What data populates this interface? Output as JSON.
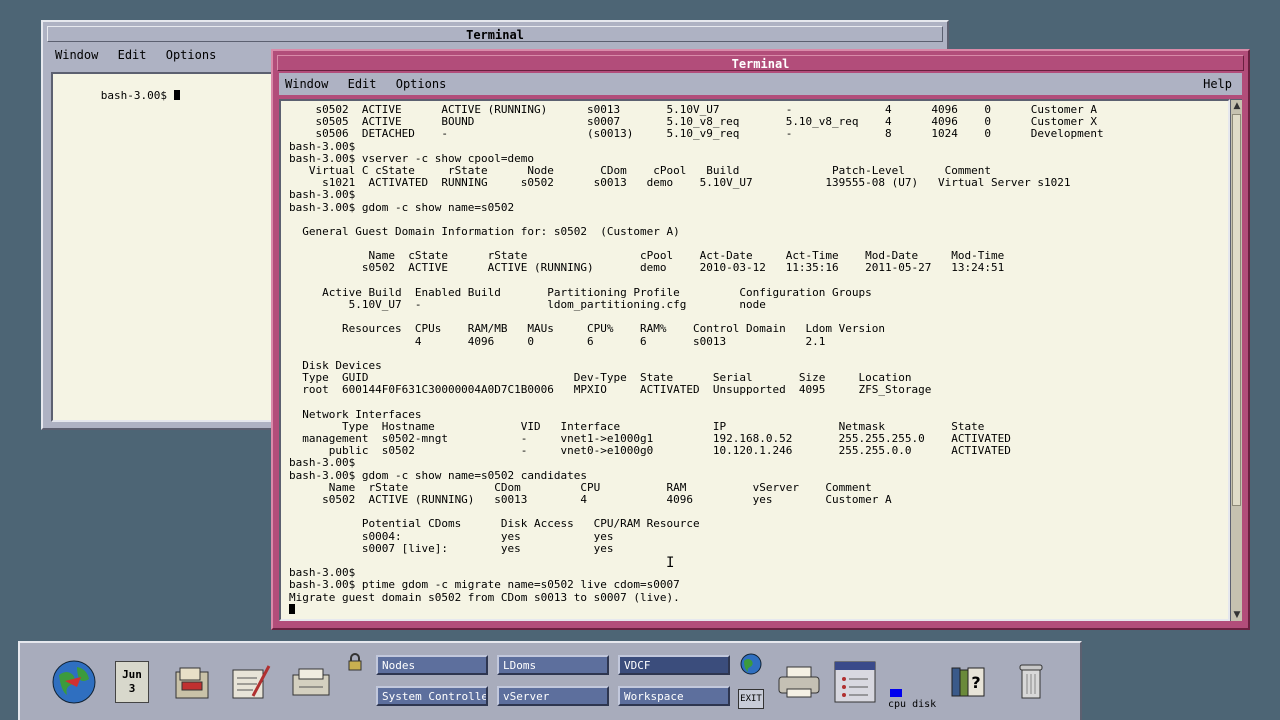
{
  "back_window": {
    "title": "Terminal",
    "menu": [
      "Window",
      "Edit",
      "Options"
    ],
    "lines": [
      "bash-3.00$ "
    ]
  },
  "front_window": {
    "title": "Terminal",
    "menu": [
      "Window",
      "Edit",
      "Options"
    ],
    "help": "Help",
    "lines": [
      "    s0502  ACTIVE      ACTIVE (RUNNING)      s0013       5.10V_U7          -              4      4096    0      Customer A",
      "    s0505  ACTIVE      BOUND                 s0007       5.10_v8_req       5.10_v8_req    4      4096    0      Customer X",
      "    s0506  DETACHED    -                     (s0013)     5.10_v9_req       -              8      1024    0      Development",
      "bash-3.00$",
      "bash-3.00$ vserver -c show cpool=demo",
      "   Virtual C cState     rState      Node       CDom    cPool   Build              Patch-Level      Comment",
      "     s1021  ACTIVATED  RUNNING     s0502      s0013   demo    5.10V_U7           139555-08 (U7)   Virtual Server s1021",
      "bash-3.00$",
      "bash-3.00$ gdom -c show name=s0502",
      "",
      "  General Guest Domain Information for: s0502  (Customer A)",
      "",
      "            Name  cState      rState                 cPool    Act-Date     Act-Time    Mod-Date     Mod-Time",
      "           s0502  ACTIVE      ACTIVE (RUNNING)       demo     2010-03-12   11:35:16    2011-05-27   13:24:51",
      "",
      "     Active Build  Enabled Build       Partitioning Profile         Configuration Groups",
      "         5.10V_U7  -                   ldom_partitioning.cfg        node",
      "",
      "        Resources  CPUs    RAM/MB   MAUs     CPU%    RAM%    Control Domain   Ldom Version",
      "                   4       4096     0        6       6       s0013            2.1",
      "",
      "  Disk Devices",
      "  Type  GUID                               Dev-Type  State      Serial       Size     Location",
      "  root  600144F0F631C30000004A0D7C1B0006   MPXIO     ACTIVATED  Unsupported  4095     ZFS_Storage",
      "",
      "  Network Interfaces",
      "        Type  Hostname             VID   Interface              IP                 Netmask          State",
      "  management  s0502-mngt           -     vnet1->e1000g1         192.168.0.52       255.255.255.0    ACTIVATED",
      "      public  s0502                -     vnet0->e1000g0         10.120.1.246       255.255.0.0      ACTIVATED",
      "bash-3.00$",
      "bash-3.00$ gdom -c show name=s0502 candidates",
      "      Name  rState             CDom         CPU          RAM          vServer    Comment",
      "     s0502  ACTIVE (RUNNING)   s0013        4            4096         yes        Customer A",
      "",
      "           Potential CDoms      Disk Access   CPU/RAM Resource",
      "           s0004:               yes           yes",
      "           s0007 [live]:        yes           yes",
      "",
      "bash-3.00$",
      "bash-3.00$ ptime gdom -c migrate name=s0502 live cdom=s0007",
      "Migrate guest domain s0502 from CDom s0013 to s0007 (live).",
      ""
    ]
  },
  "front_panel": {
    "date": {
      "month": "Jun",
      "day": "3"
    },
    "workspaces": [
      "Nodes",
      "LDoms",
      "VDCF",
      "System Controlle",
      "vServer",
      "Workspace"
    ],
    "current_workspace": "VDCF",
    "exit_label": "EXIT",
    "cpu_disk_label": "cpu disk"
  }
}
